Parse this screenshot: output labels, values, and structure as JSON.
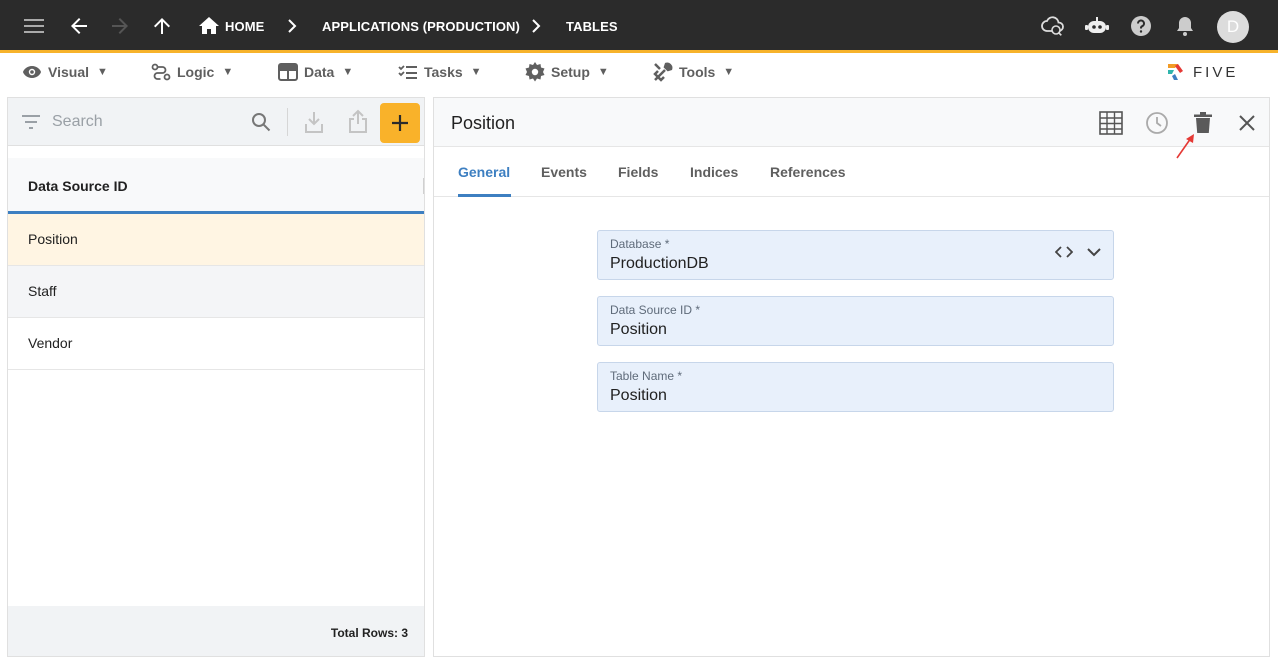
{
  "topbar": {
    "breadcrumb": {
      "home": "HOME",
      "app": "APPLICATIONS (PRODUCTION)",
      "section": "TABLES"
    },
    "avatar_initial": "D",
    "accent_color": "#f7b32b",
    "bg_color": "#2b2b2b"
  },
  "menubar": {
    "items": [
      {
        "label": "Visual",
        "icon": "eye-icon"
      },
      {
        "label": "Logic",
        "icon": "logic-icon"
      },
      {
        "label": "Data",
        "icon": "table-icon"
      },
      {
        "label": "Tasks",
        "icon": "tasks-icon"
      },
      {
        "label": "Setup",
        "icon": "gear-icon"
      },
      {
        "label": "Tools",
        "icon": "tools-icon"
      }
    ],
    "dropdown_glyph": "▼",
    "logo_text": "FIVE"
  },
  "list": {
    "search_placeholder": "Search",
    "column_header": "Data Source ID",
    "rows": [
      "Position",
      "Staff",
      "Vendor"
    ],
    "selected_index": 0,
    "footer": "Total Rows: 3"
  },
  "detail": {
    "title": "Position",
    "tabs": [
      "General",
      "Events",
      "Fields",
      "Indices",
      "References"
    ],
    "active_tab": "General",
    "fields": [
      {
        "label": "Database *",
        "value": "ProductionDB"
      },
      {
        "label": "Data Source ID *",
        "value": "Position"
      },
      {
        "label": "Table Name *",
        "value": "Position"
      }
    ]
  },
  "colors": {
    "primary": "#3d7fc1",
    "add_button": "#f9b22a",
    "selected_row": "#fff5e3",
    "field_bg": "#e8f0fb",
    "annotation": "#e53935"
  }
}
